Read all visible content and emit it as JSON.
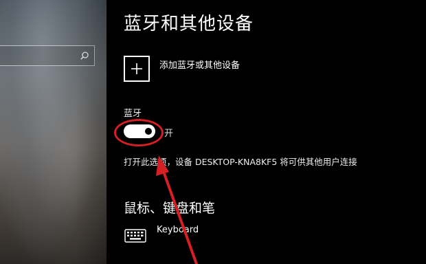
{
  "left_panel": {
    "search": {
      "placeholder": "",
      "icon": "search-icon"
    }
  },
  "main": {
    "title": "蓝牙和其他设备",
    "add_device": {
      "label": "添加蓝牙或其他设备",
      "icon": "plus-icon"
    },
    "bluetooth": {
      "label": "蓝牙",
      "toggle_state": "开",
      "description": "打开此选项，设备 DESKTOP-KNA8KF5 将可供其他用户连接"
    },
    "section_mouse_keyboard_pen": {
      "title": "鼠标、键盘和笔",
      "devices": [
        {
          "name": "Keyboard",
          "icon": "keyboard-icon"
        }
      ]
    }
  },
  "annotation": {
    "color": "#d41f25"
  }
}
